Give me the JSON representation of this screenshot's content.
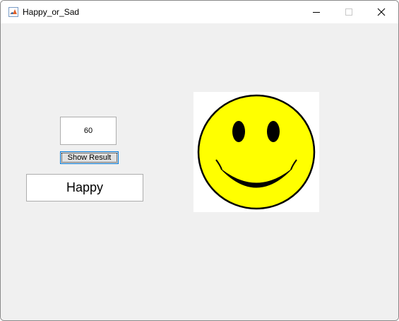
{
  "window": {
    "title": "Happy_or_Sad",
    "controls": {
      "minimize": "minimize",
      "maximize": "maximize",
      "close": "close"
    }
  },
  "form": {
    "value_field": "60",
    "show_button_label": "Show Result",
    "result_label": "Happy"
  },
  "image": {
    "icon": "smiley-face-icon",
    "face_color": "#ffff00",
    "outline_color": "#000000"
  },
  "colors": {
    "window_background": "#f0f0f0",
    "titlebar_background": "#ffffff",
    "button_focus_border": "#0078d7"
  }
}
